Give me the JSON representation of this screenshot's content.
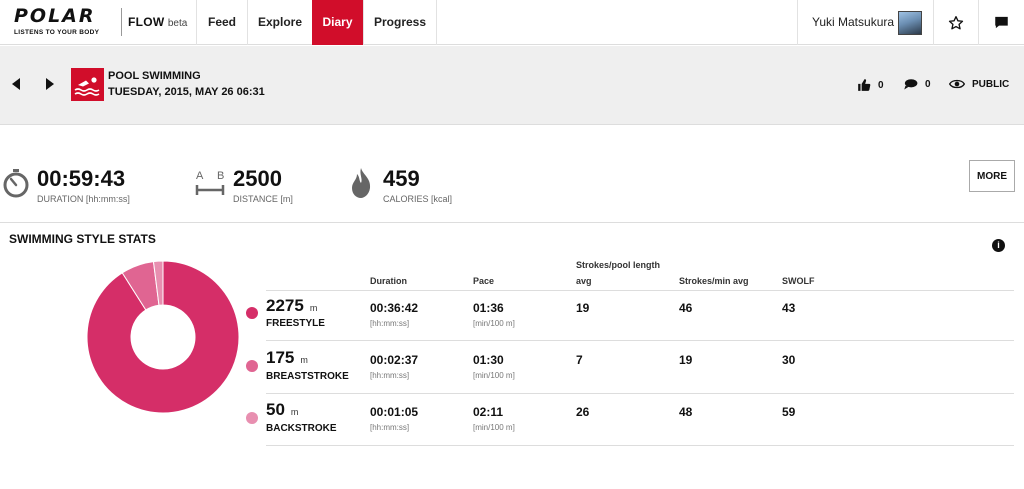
{
  "brand": {
    "logo_word": "POLAR",
    "logo_tagline": "LISTENS TO YOUR BODY",
    "app_name": "FLOW",
    "app_suffix": "beta",
    "accent_color": "#d10d2a"
  },
  "nav": {
    "items": [
      {
        "label": "Feed"
      },
      {
        "label": "Explore"
      },
      {
        "label": "Diary",
        "active": true
      },
      {
        "label": "Progress"
      }
    ],
    "user_name": "Yuki Matsukura",
    "icons": [
      "star-icon",
      "chat-bubble-icon"
    ]
  },
  "activity": {
    "sport": "POOL SWIMMING",
    "datetime": "TUESDAY, 2015, MAY 26 06:31",
    "likes": "0",
    "comments": "0",
    "visibility": "PUBLIC",
    "icons": [
      "previous-arrow-icon",
      "next-arrow-icon",
      "swimmer-icon",
      "thumbs-up-icon",
      "comment-icon",
      "eye-icon"
    ]
  },
  "summary": {
    "duration": {
      "value": "00:59:43",
      "label": "DURATION [hh:mm:ss]"
    },
    "distance": {
      "value": "2500",
      "label": "DISTANCE [m]",
      "icon_letters": [
        "A",
        "B"
      ]
    },
    "calories": {
      "value": "459",
      "label": "CALORIES [kcal]"
    },
    "more_label": "MORE",
    "icons": [
      "stopwatch-icon",
      "distance-icon",
      "flame-icon"
    ]
  },
  "swim_stats": {
    "title": "SWIMMING STYLE STATS",
    "info_icon": "i",
    "columns": {
      "duration": "Duration",
      "pace": "Pace",
      "strokes_pool_line1": "Strokes/pool length",
      "strokes_pool_line2": "avg",
      "strokes_min": "Strokes/min avg",
      "swolf": "SWOLF"
    },
    "rows": [
      {
        "meters": "2275",
        "unit": "m",
        "style": "FREESTYLE",
        "duration": "00:36:42",
        "duration_unit": "[hh:mm:ss]",
        "pace": "01:36",
        "pace_unit": "[min/100 m]",
        "strokes_pool": "19",
        "strokes_min": "46",
        "swolf": "43",
        "color": "#d52e68"
      },
      {
        "meters": "175",
        "unit": "m",
        "style": "BREASTSTROKE",
        "duration": "00:02:37",
        "duration_unit": "[hh:mm:ss]",
        "pace": "01:30",
        "pace_unit": "[min/100 m]",
        "strokes_pool": "7",
        "strokes_min": "19",
        "swolf": "30",
        "color": "#e06592"
      },
      {
        "meters": "50",
        "unit": "m",
        "style": "BACKSTROKE",
        "duration": "00:01:05",
        "duration_unit": "[hh:mm:ss]",
        "pace": "02:11",
        "pace_unit": "[min/100 m]",
        "strokes_pool": "26",
        "strokes_min": "48",
        "swolf": "59",
        "color": "#e88fb0"
      }
    ]
  }
}
